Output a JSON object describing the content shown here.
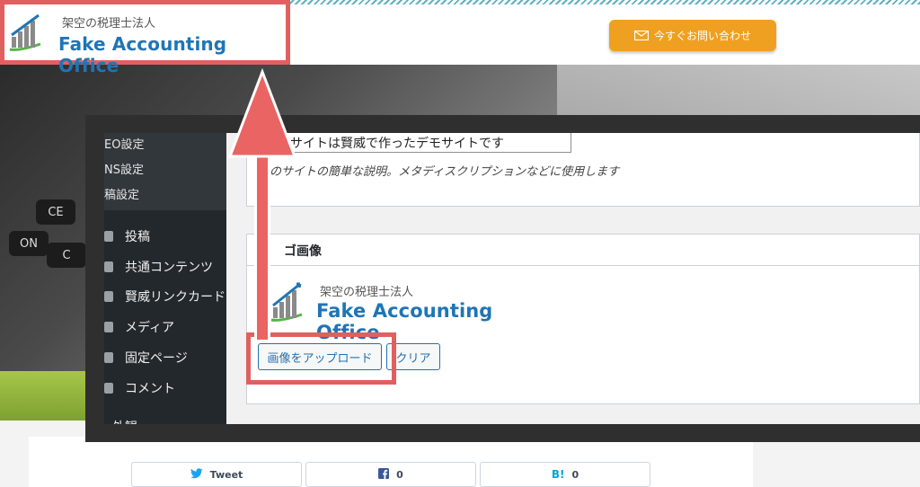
{
  "header": {
    "logo_jp": "架空の税理士法人",
    "logo_en": "Fake Accounting Office",
    "contact_button": "今すぐお問い合わせ"
  },
  "sidebar": {
    "sub_items": [
      "EO設定",
      "NS設定",
      "稿設定"
    ],
    "items": [
      {
        "label": "投稿",
        "icon": "pin-icon"
      },
      {
        "label": "共通コンテンツ",
        "icon": "doc-icon"
      },
      {
        "label": "賢威リンクカード",
        "icon": "doc-icon"
      },
      {
        "label": "メディア",
        "icon": "media-icon"
      },
      {
        "label": "固定ページ",
        "icon": "page-icon"
      },
      {
        "label": "コメント",
        "icon": "comment-icon"
      }
    ],
    "partial_item": "外観"
  },
  "settings": {
    "site_title_value": "サイトは賢威で作ったデモサイトです",
    "site_title_desc": "のサイトの簡単な説明。メタディスクリプションなどに使用します",
    "logo_section_title": "ゴ画像",
    "upload_button": "画像をアップロード",
    "clear_button": "クリア"
  },
  "share": {
    "tweet_label": "Tweet",
    "facebook_count": "0",
    "hatena_count": "0"
  },
  "colors": {
    "accent_orange": "#f0a020",
    "highlight_red": "#e06060",
    "logo_blue": "#1f75b5",
    "wp_link_blue": "#2271b1"
  },
  "hero_keys": [
    "CE",
    "ON",
    "C"
  ]
}
